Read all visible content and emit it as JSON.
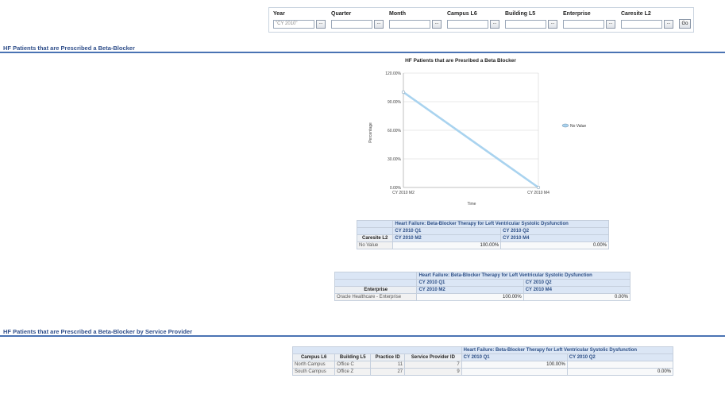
{
  "prompts": {
    "year": {
      "label": "Year",
      "value": "\"CY 2010\""
    },
    "quarter": {
      "label": "Quarter",
      "value": ""
    },
    "month": {
      "label": "Month",
      "value": ""
    },
    "campus": {
      "label": "Campus L6",
      "value": ""
    },
    "building": {
      "label": "Building L5",
      "value": ""
    },
    "enterprise": {
      "label": "Enterprise",
      "value": ""
    },
    "caresite": {
      "label": "Caresite L2",
      "value": ""
    },
    "browse_label": "...",
    "go_label": "Go"
  },
  "section1": {
    "title": "HF Patients that are Prescribed a Beta-Blocker"
  },
  "section2": {
    "title": "HF Patients that are Prescribed a Beta-Blocker by Service Provider"
  },
  "chart_data": {
    "type": "line",
    "title": "HF Patients that are Presribed a Beta Blocker",
    "xlabel": "Time",
    "ylabel": "Percentage",
    "categories": [
      "CY 2010 M2",
      "CY 2010 M4"
    ],
    "series": [
      {
        "name": "No Value",
        "values": [
          100,
          0
        ],
        "color": "#a9d3ef"
      }
    ],
    "yticks": [
      "0.00%",
      "30.00%",
      "60.00%",
      "90.00%",
      "120.00%"
    ],
    "ylim": [
      0,
      120
    ],
    "grid": true,
    "legend": "right"
  },
  "table1": {
    "measure": "Heart Failure: Beta-Blocker Therapy for Left Ventricular Systolic Dysfunction",
    "q1": "CY 2010 Q1",
    "q2": "CY 2010 Q2",
    "row_header": "Caresite L2",
    "m2": "CY 2010 M2",
    "m4": "CY 2010 M4",
    "row_label": "No Value",
    "v1": "100.00%",
    "v2": "0.00%"
  },
  "table2": {
    "measure": "Heart Failure: Beta-Blocker Therapy for Left Ventricular Systolic Dysfunction",
    "q1": "CY 2010 Q1",
    "q2": "CY 2010 Q2",
    "row_header": "Enterprise",
    "m2": "CY 2010 M2",
    "m4": "CY 2010 M4",
    "row_label": "Oracle Healthcare - Enterprise",
    "v1": "100.00%",
    "v2": "0.00%"
  },
  "table3": {
    "measure": "Heart Failure: Beta-Blocker Therapy for Left Ventricular Systolic Dysfunction",
    "col_campus": "Campus L6",
    "col_building": "Building L5",
    "col_practice": "Practice ID",
    "col_provider": "Service Provider ID",
    "q1": "CY 2010 Q1",
    "q2": "CY 2010 Q2",
    "rows": [
      {
        "campus": "North Campus",
        "building": "Office C",
        "practice": "11",
        "provider": "7",
        "q1": "100.00%",
        "q2": ""
      },
      {
        "campus": "South Campus",
        "building": "Office Z",
        "practice": "27",
        "provider": "9",
        "q1": "",
        "q2": "0.00%"
      }
    ]
  }
}
